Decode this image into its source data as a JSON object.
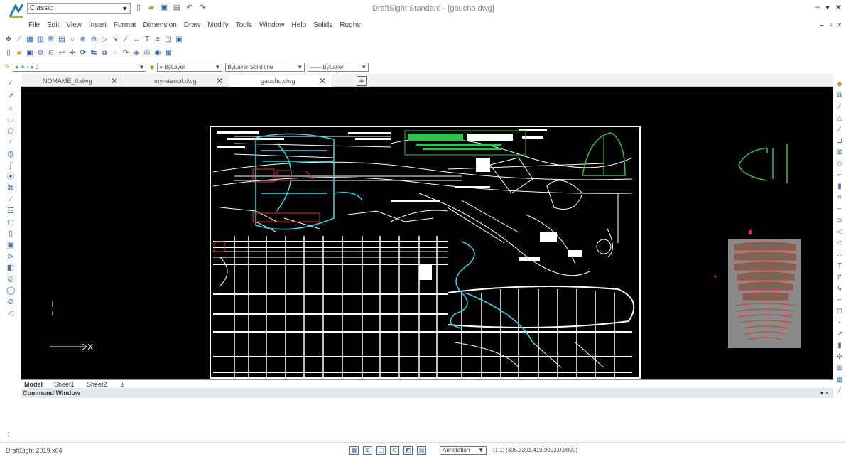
{
  "app": {
    "window_title": "DraftSight Standard - [gaucho.dwg]",
    "workspace": "Classic",
    "status_app_name": "DraftSight 2019 x64"
  },
  "menu": [
    "File",
    "Edit",
    "View",
    "Insert",
    "Format",
    "Dimension",
    "Draw",
    "Modify",
    "Tools",
    "Window",
    "Help",
    "Solids",
    "Rughs"
  ],
  "layer_bar": {
    "layer": "0",
    "color": "ByLayer",
    "linetype": "ByLayer    Solid line",
    "lineweight": "ByLayer"
  },
  "tabs": [
    {
      "label": "NOMAME_0.dwg",
      "active": false
    },
    {
      "label": "my-stencil.dwg",
      "active": false
    },
    {
      "label": "gaucho.dwg",
      "active": true
    }
  ],
  "sheets": [
    "Model",
    "Sheet1",
    "Sheet2"
  ],
  "command_window": {
    "title": "Command Window",
    "prompt": ":"
  },
  "status": {
    "toggles": [
      "snap",
      "grid",
      "ortho",
      "polar",
      "esnap",
      "etrack"
    ],
    "annotation_label": "Annotation",
    "scale": "(1:1)",
    "coordinates": "(305.3391,419.9003,0.0000)"
  },
  "colors": {
    "canvas_bg": "#000000",
    "drawing_lines": "#ffffff",
    "cyan_overlay": "#3fd4e6",
    "green_text": "#33c24a",
    "red_marks": "#e23030",
    "parts_panel": "#8a8a8a"
  }
}
